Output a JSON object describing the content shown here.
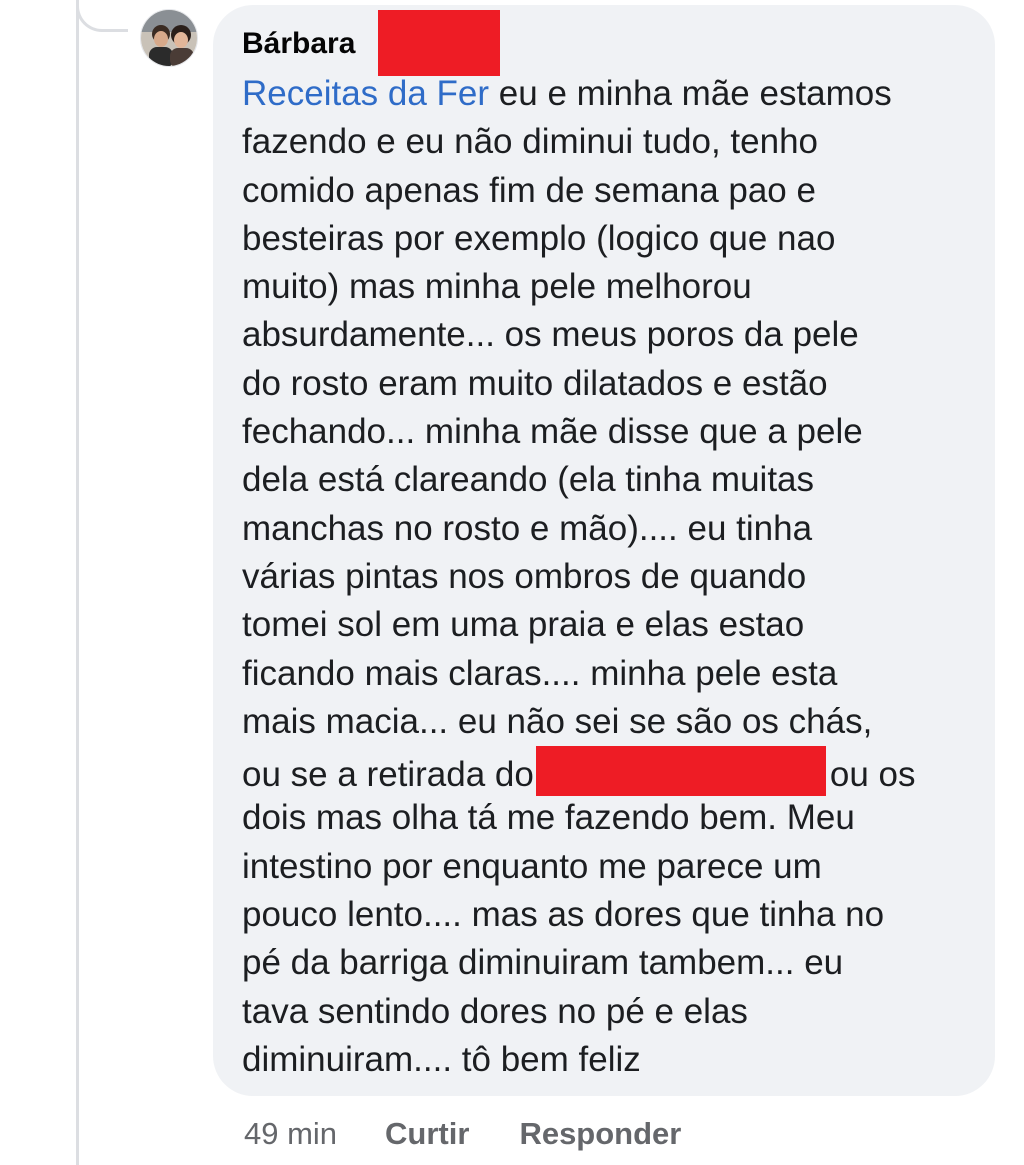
{
  "comment": {
    "author": "Bárbara",
    "mention": "Receitas da Fer",
    "lines": [
      " eu e minha mãe estamos",
      "fazendo e eu não diminui tudo, tenho",
      "comido apenas fim de semana pao e",
      "besteiras por exemplo (logico que nao",
      "muito) mas minha pele melhorou",
      "absurdamente... os meus poros da pele",
      "do rosto eram muito dilatados e estão",
      "fechando... minha mãe disse que a pele",
      "dela está clareando (ela tinha muitas",
      "manchas no rosto e mão)....  eu tinha",
      "várias pintas nos ombros de quando",
      "tomei sol em uma praia e elas estao",
      "ficando mais claras.... minha pele esta",
      "mais macia... eu não sei se são os chás,",
      "ou se a retirada do",
      "ou os",
      "dois mas olha tá me fazendo bem. Meu",
      "intestino por enquanto me parece um",
      "pouco lento.... mas as dores que tinha no",
      "pé da barriga diminuiram tambem... eu",
      "tava sentindo dores no pé e elas",
      "diminuiram....  tô bem feliz"
    ],
    "redaction_color": "#ee1c25"
  },
  "actions": {
    "time": "49 min",
    "like": "Curtir",
    "reply": "Responder"
  },
  "colors": {
    "bubble": "#f0f2f5",
    "mention": "#2f6cc8",
    "text": "#1c1e21",
    "secondary": "#65676b"
  }
}
